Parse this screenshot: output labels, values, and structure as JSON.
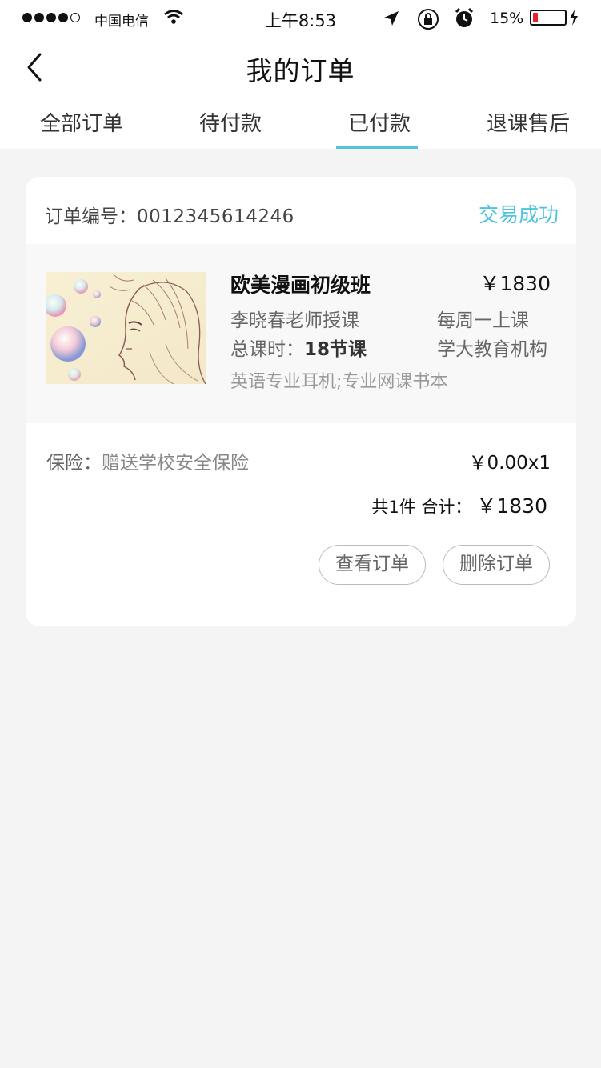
{
  "status_bar": {
    "carrier": "中国电信",
    "time": "上午8:53",
    "battery_percent": "15%",
    "battery_level": 0.15,
    "battery_color": "#e5232a"
  },
  "nav": {
    "back_icon": "chevron-left-icon",
    "title": "我的订单"
  },
  "tabs": [
    {
      "label": "全部订单",
      "active": false
    },
    {
      "label": "待付款",
      "active": false
    },
    {
      "label": "已付款",
      "active": true
    },
    {
      "label": "退课售后",
      "active": false
    }
  ],
  "accent_color": "#4fc3dc",
  "order": {
    "number_label": "订单编号：",
    "number": "0012345614246",
    "status": "交易成功",
    "item": {
      "image": "manga-illustration-thumbnail",
      "name": "欧美漫画初级班",
      "price": "￥1830",
      "teacher": "李晓春老师授课",
      "schedule": "每周一上课",
      "hours_label": "总课时：",
      "hours_value": "18节课",
      "organization": "学大教育机构",
      "extras": "英语专业耳机;专业网课书本"
    },
    "insurance_label": "保险：",
    "insurance_value": "赠送学校安全保险",
    "insurance_price": "￥0.00x1",
    "total_label": "共1件 合计：",
    "total_amount": "￥1830",
    "buttons": {
      "view": "查看订单",
      "delete": "删除订单"
    }
  }
}
